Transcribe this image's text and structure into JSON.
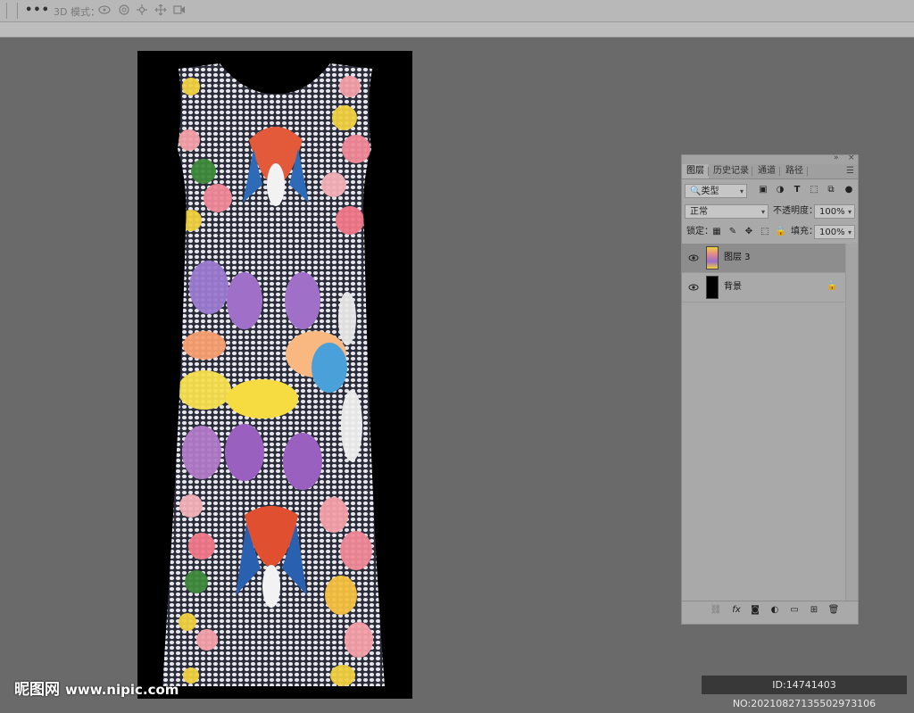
{
  "options_bar": {
    "more_label": "•••",
    "mode_3d_label": "3D 模式：",
    "icons": [
      "orbit-3d-icon",
      "roll-3d-icon",
      "pan-3d-icon",
      "slide-3d-icon",
      "scale-3d-icon"
    ]
  },
  "canvas": {
    "background": "#000000",
    "content": "printed-dress-pattern"
  },
  "layers_panel": {
    "tabs": [
      "图层",
      "历史记录",
      "通道",
      "路径"
    ],
    "active_tab": "图层",
    "filter": {
      "value": "类型"
    },
    "filter_icons": [
      "image-filter-icon",
      "adjustment-filter-icon",
      "type-filter-icon",
      "shape-filter-icon",
      "smart-object-filter-icon"
    ],
    "blend_mode": "正常",
    "opacity_label": "不透明度：",
    "opacity_value": "100%",
    "lock_label": "锁定：",
    "fill_label": "填充：",
    "fill_value": "100%",
    "layers": [
      {
        "name": "图层 3",
        "visible": true,
        "selected": true,
        "locked": false
      },
      {
        "name": "背景",
        "visible": true,
        "selected": false,
        "locked": true
      }
    ],
    "bottom_icons": [
      "link-layers-icon",
      "fx-icon",
      "add-mask-icon",
      "adjustment-layer-icon",
      "new-group-icon",
      "new-layer-icon",
      "delete-layer-icon"
    ],
    "fx_label": "fx"
  },
  "watermark": {
    "site_name": "昵图网",
    "site_url": "www.nipic.com",
    "id_text": "ID:14741403 NO:20210827135502973106"
  }
}
